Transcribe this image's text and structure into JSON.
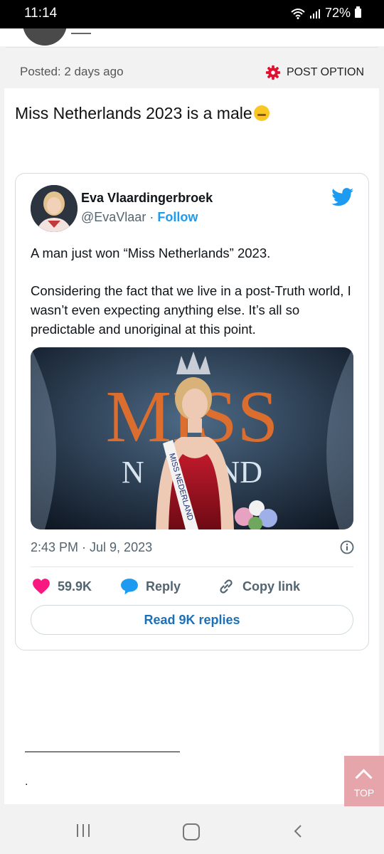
{
  "status_bar": {
    "time": "11:14",
    "battery": "72%"
  },
  "post_header": {
    "posted": "Posted: 2 days ago",
    "post_option": "POST OPTION"
  },
  "post": {
    "title": "Miss Netherlands 2023 is a male"
  },
  "tweet": {
    "author_name": "Eva Vlaardingerbroek",
    "handle": "@EvaVlaar",
    "separator": "·",
    "follow": "Follow",
    "paragraph_1": "A man just won “Miss Netherlands” 2023.",
    "paragraph_2": "Considering the fact that we live in a post-Truth world, I wasn’t even expecting anything else. It’s all so predictable and unoriginal at this point.",
    "image_text": {
      "miss": "MISS",
      "land": "N    LAND",
      "sash": "MISS NEDERLAND"
    },
    "timestamp": "2:43 PM · Jul 9, 2023",
    "likes": "59.9K",
    "reply": "Reply",
    "copy_link": "Copy link",
    "read_replies": "Read 9K replies"
  },
  "footer": {
    "dot": ".",
    "top_button": "TOP"
  },
  "colors": {
    "twitter_blue": "#1d9bf0",
    "like_pink": "#f91880",
    "gear_red": "#e0102f",
    "top_button_bg": "#e5a5aa"
  }
}
